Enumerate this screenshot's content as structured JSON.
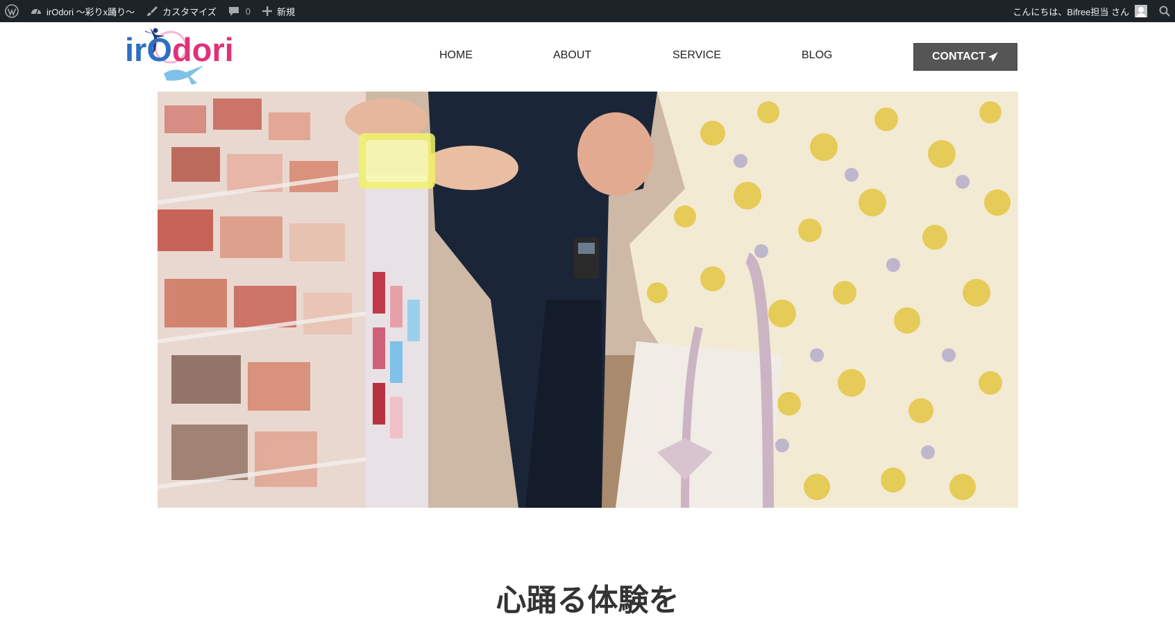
{
  "admin_bar": {
    "site_name": "irOdori 〜彩りx踊り〜",
    "customize_label": "カスタマイズ",
    "comments_count": "0",
    "new_label": "新規",
    "greeting": "こんにちは、Bifree担当 さん",
    "icons": [
      "wordpress-icon",
      "dashboard-icon",
      "brush-icon",
      "comment-icon",
      "plus-icon",
      "avatar",
      "search-icon"
    ]
  },
  "site": {
    "logo": {
      "text_part1": "ir",
      "text_part2": "O",
      "text_part3": "dori",
      "brand_blue": "#2f6fc1",
      "brand_pink": "#e0327a",
      "accent_light_blue": "#7fc1e8"
    }
  },
  "nav": {
    "items": [
      {
        "label": "HOME"
      },
      {
        "label": "ABOUT"
      },
      {
        "label": "SERVICE"
      },
      {
        "label": "BLOG"
      }
    ],
    "contact_label": "CONTACT",
    "contact_bg": "#555555"
  },
  "hero": {
    "description_icon": "photo-shoppers-cosmetics"
  },
  "main": {
    "heading": "心踊る体験を"
  },
  "colors": {
    "admin_bar_bg": "#1d2327",
    "heading": "#333333"
  }
}
